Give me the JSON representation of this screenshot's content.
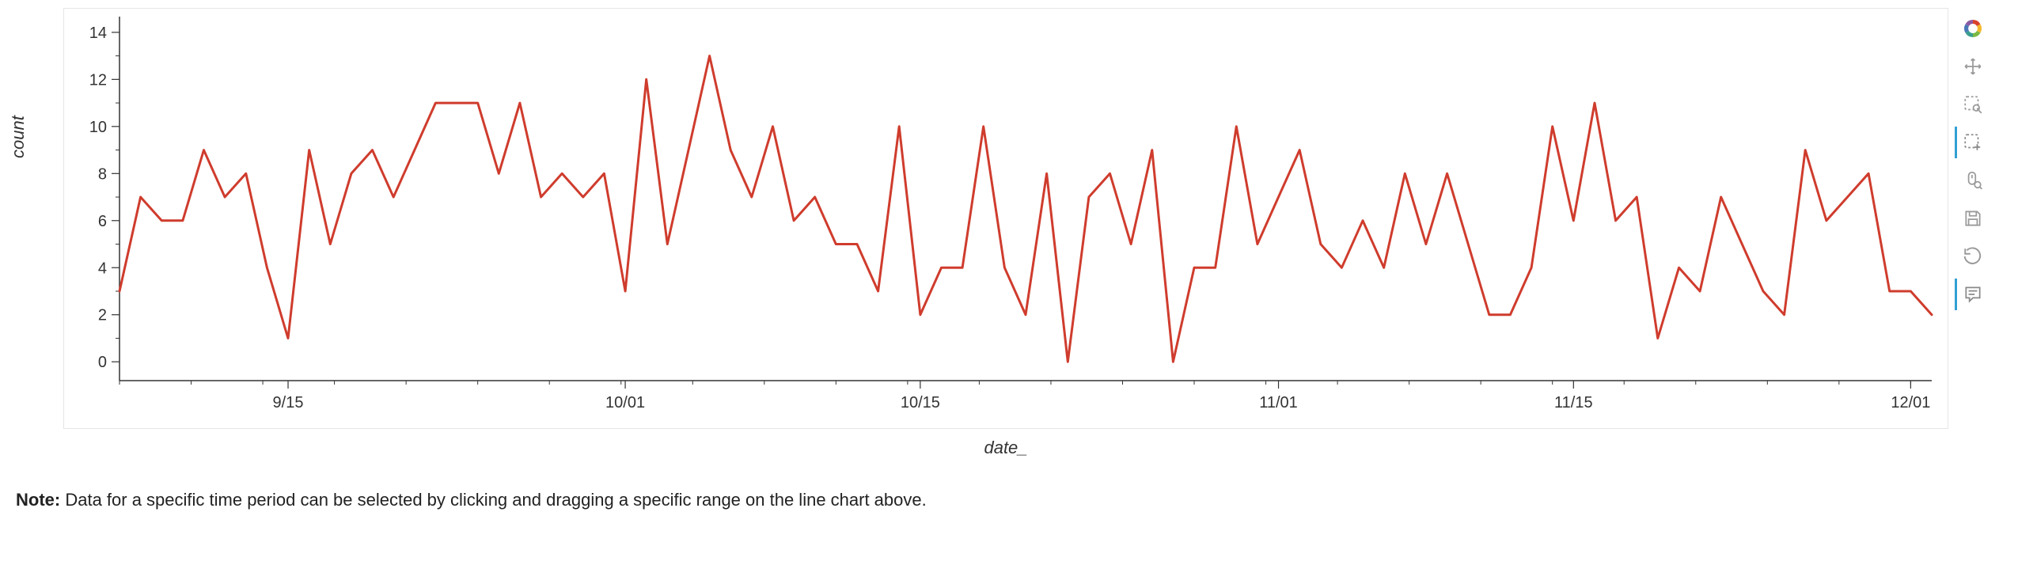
{
  "chart_data": {
    "type": "line",
    "xlabel": "date_",
    "ylabel": "count",
    "ylim": [
      -0.8,
      14.5
    ],
    "y_ticks": [
      0,
      2,
      4,
      6,
      8,
      10,
      12,
      14
    ],
    "x_tick_labels": [
      "9/15",
      "10/01",
      "10/15",
      "11/01",
      "11/15",
      "12/01"
    ],
    "x_tick_positions_days": [
      8,
      24,
      38,
      55,
      69,
      85
    ],
    "x": [
      0,
      1,
      2,
      3,
      4,
      5,
      6,
      7,
      8,
      9,
      10,
      11,
      12,
      13,
      14,
      15,
      16,
      17,
      18,
      19,
      20,
      21,
      22,
      23,
      24,
      25,
      26,
      27,
      28,
      29,
      30,
      31,
      32,
      33,
      34,
      35,
      36,
      37,
      38,
      39,
      40,
      41,
      42,
      43,
      44,
      45,
      46,
      47,
      48,
      49,
      50,
      51,
      52,
      53,
      54,
      55,
      56,
      57,
      58,
      59,
      60,
      61,
      62,
      63,
      64,
      65,
      66,
      67,
      68,
      69,
      70,
      71,
      72,
      73,
      74,
      75,
      76,
      77,
      78,
      79,
      80,
      81,
      82,
      83,
      84,
      85,
      86
    ],
    "series": [
      {
        "name": "count",
        "color": "#cf3c2d",
        "values": [
          3,
          7,
          6,
          6,
          9,
          7,
          8,
          4,
          1,
          9,
          5,
          8,
          9,
          7,
          9,
          11,
          11,
          11,
          8,
          11,
          7,
          8,
          7,
          8,
          3,
          12,
          5,
          9,
          13,
          9,
          7,
          10,
          6,
          7,
          5,
          5,
          3,
          10,
          2,
          4,
          4,
          10,
          4,
          2,
          8,
          0,
          7,
          8,
          5,
          9,
          0,
          4,
          4,
          10,
          5,
          7,
          9,
          5,
          4,
          6,
          4,
          8,
          5,
          8,
          5,
          2,
          2,
          4,
          10,
          6,
          11,
          6,
          7,
          1,
          4,
          3,
          7,
          5,
          3,
          2,
          9,
          6,
          7,
          8,
          3,
          3,
          2
        ]
      }
    ]
  },
  "toolbar": {
    "logo": "bokeh-logo-icon",
    "tools": [
      {
        "name": "pan-icon",
        "active": false
      },
      {
        "name": "box-zoom-icon",
        "active": false
      },
      {
        "name": "box-select-icon",
        "active": true
      },
      {
        "name": "wheel-zoom-icon",
        "active": false
      },
      {
        "name": "save-icon",
        "active": false
      },
      {
        "name": "reset-icon",
        "active": false
      },
      {
        "name": "hover-icon",
        "active": true
      }
    ]
  },
  "note_label": "Note:",
  "note_text": " Data for a specific time period can be selected by clicking and dragging a specific range on the line chart above."
}
